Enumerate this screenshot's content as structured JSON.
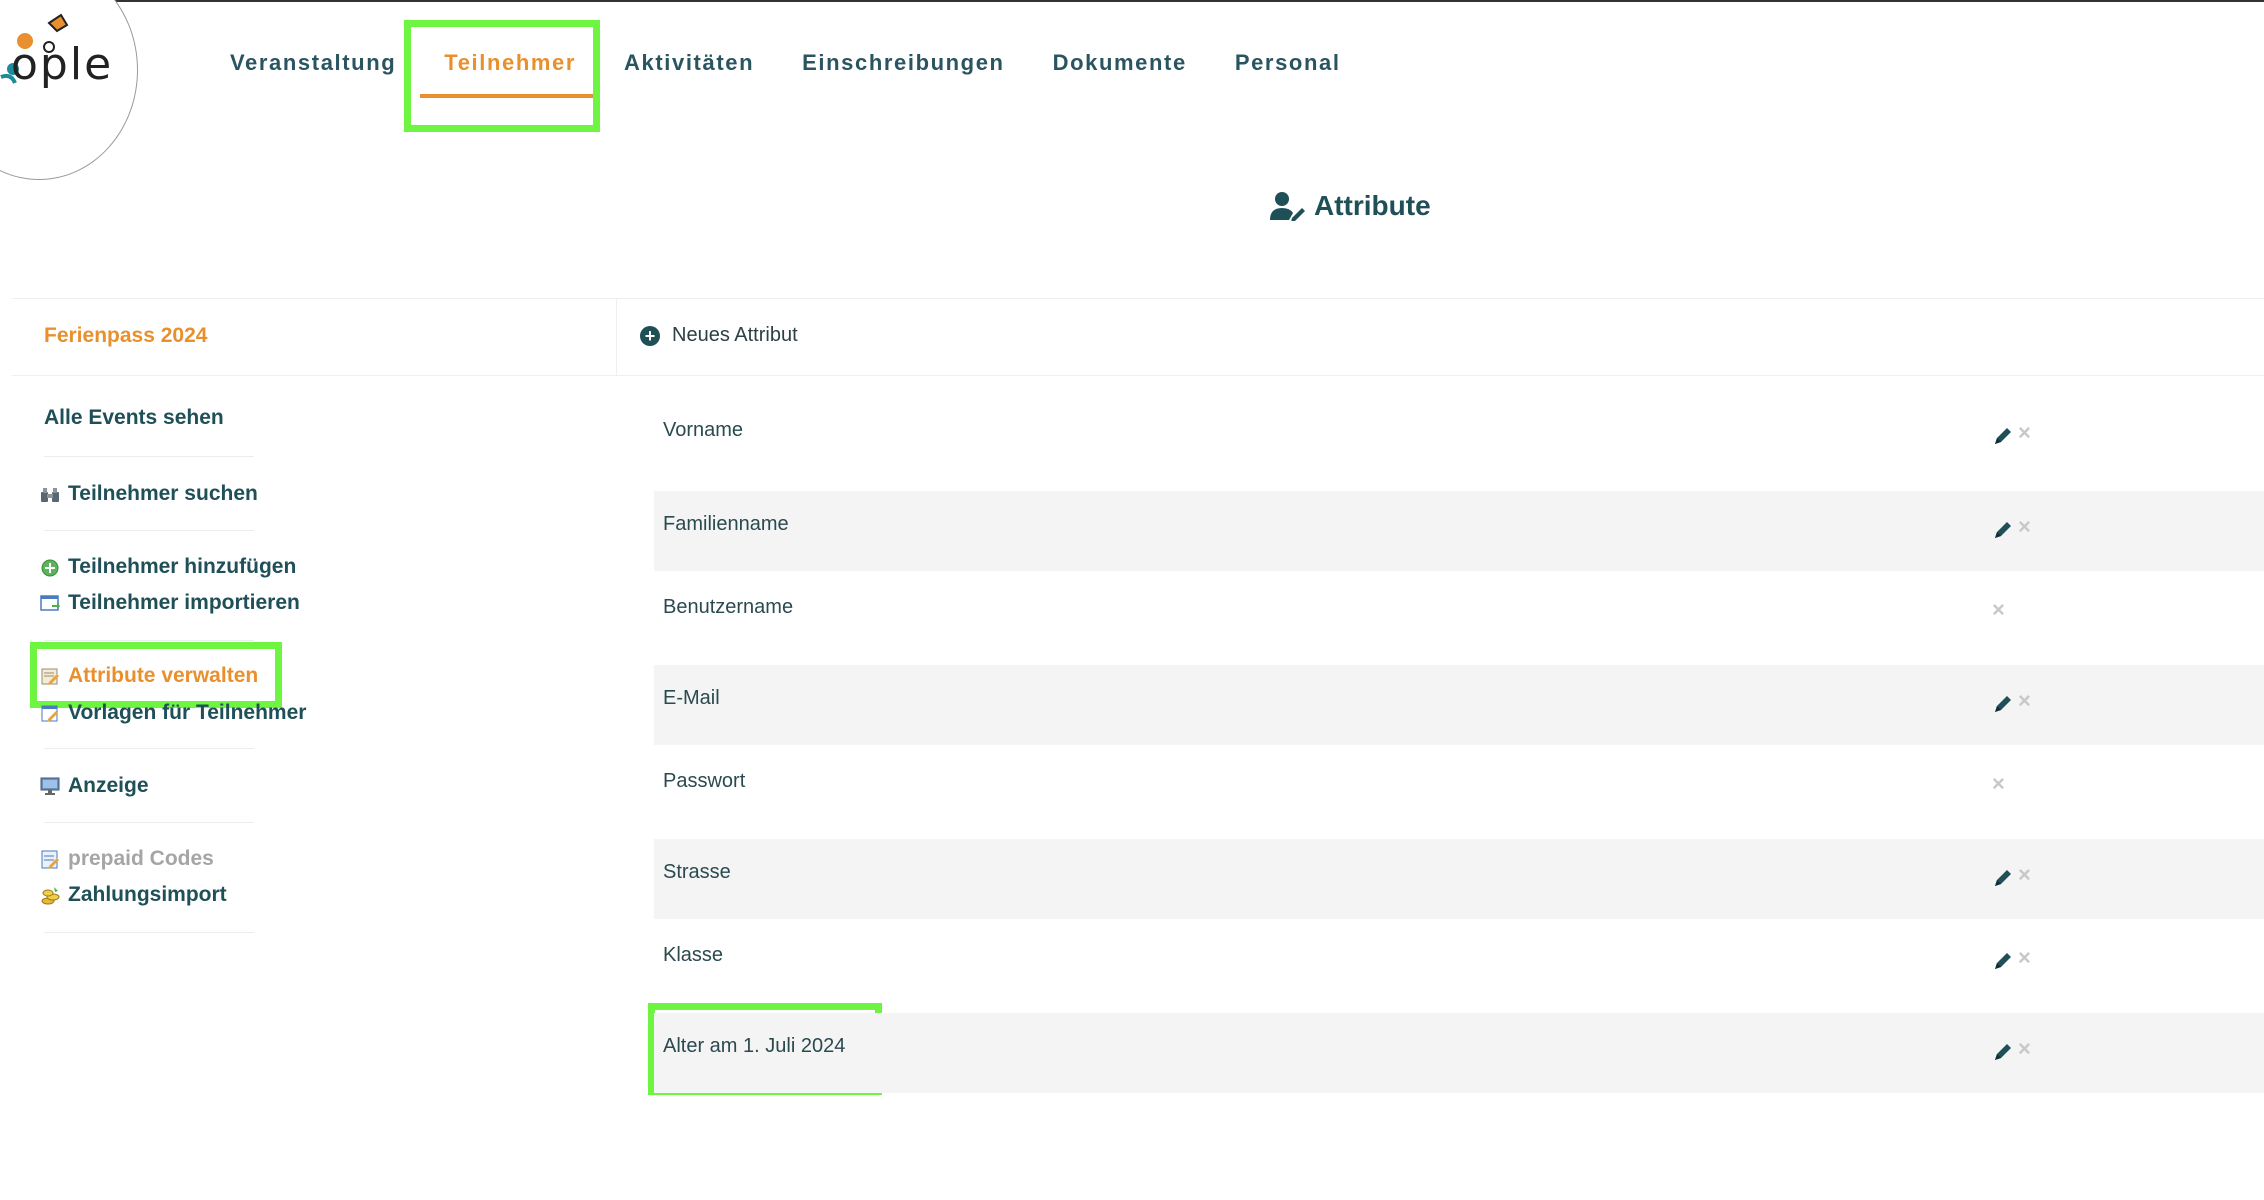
{
  "logo": {
    "text": "ople"
  },
  "nav": {
    "items": [
      {
        "label": "Veranstaltung",
        "active": false
      },
      {
        "label": "Teilnehmer",
        "active": true
      },
      {
        "label": "Aktivitäten",
        "active": false
      },
      {
        "label": "Einschreibungen",
        "active": false
      },
      {
        "label": "Dokumente",
        "active": false
      },
      {
        "label": "Personal",
        "active": false
      }
    ]
  },
  "page": {
    "title": "Attribute",
    "title_icon": "user-edit-icon"
  },
  "header": {
    "event_name": "Ferienpass 2024",
    "new_attribute_label": "Neues Attribut"
  },
  "sidebar": {
    "all_events": "Alle Events sehen",
    "items": [
      {
        "label": "Teilnehmer suchen",
        "icon": "binoculars-icon"
      },
      {
        "label": "Teilnehmer hinzufügen",
        "icon": "add-circle-icon"
      },
      {
        "label": "Teilnehmer importieren",
        "icon": "import-window-icon"
      },
      {
        "label": "Attribute verwalten",
        "icon": "edit-list-icon",
        "active": true
      },
      {
        "label": "Vorlagen für Teilnehmer",
        "icon": "template-edit-icon"
      },
      {
        "label": "Anzeige",
        "icon": "monitor-icon"
      },
      {
        "label": "prepaid Codes",
        "icon": "prepaid-card-icon",
        "disabled": true
      },
      {
        "label": "Zahlungsimport",
        "icon": "coins-icon"
      }
    ]
  },
  "attributes": [
    {
      "label": "Vorname",
      "editable": true,
      "deletable": true
    },
    {
      "label": "Familienname",
      "editable": true,
      "deletable": true
    },
    {
      "label": "Benutzername",
      "editable": false,
      "deletable": true
    },
    {
      "label": "E-Mail",
      "editable": true,
      "deletable": true
    },
    {
      "label": "Passwort",
      "editable": false,
      "deletable": true
    },
    {
      "label": "Strasse",
      "editable": true,
      "deletable": true
    },
    {
      "label": "Klasse",
      "editable": true,
      "deletable": true
    },
    {
      "label": "Alter am 1. Juli 2024",
      "editable": true,
      "deletable": true
    }
  ],
  "colors": {
    "accent": "#e8902e",
    "primary": "#1f4f57",
    "highlight": "#6ef542",
    "row_alt": "#f4f4f4"
  }
}
